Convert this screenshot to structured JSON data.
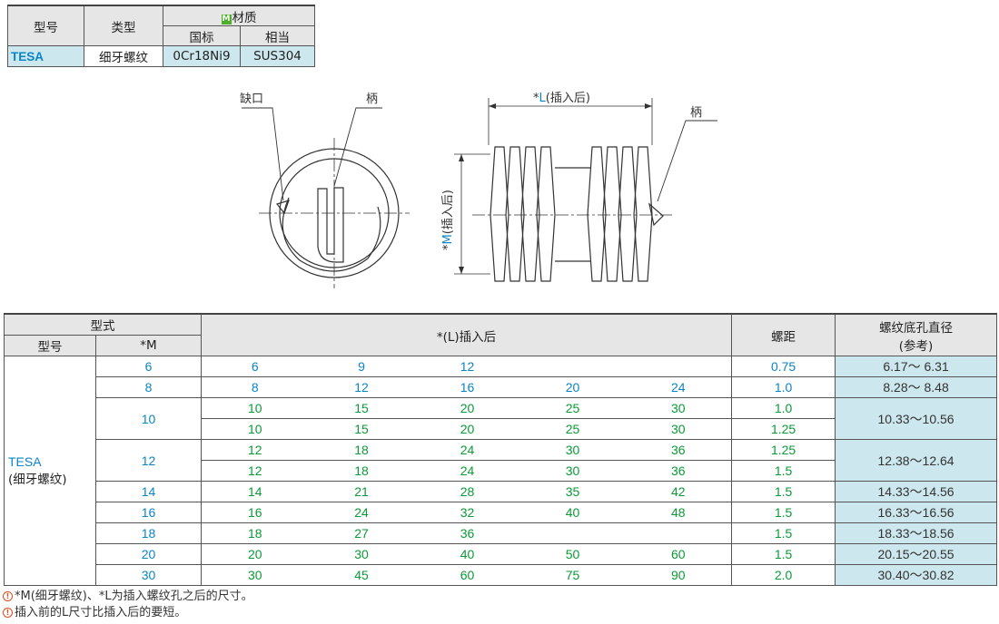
{
  "material_table": {
    "col_model": "型号",
    "col_type": "类型",
    "col_material": "材质",
    "material_badge": "M",
    "col_std": "国标",
    "col_equiv": "相当",
    "row": {
      "model": "TESA",
      "type": "细牙螺纹",
      "std": "0Cr18Ni9",
      "equiv": "SUS304"
    }
  },
  "drawing": {
    "notch_label": "缺口",
    "tang_label": "柄",
    "tang_label_side": "柄",
    "L_label_prefix": "*",
    "L_label_letter": "L",
    "L_label_suffix": "(插入后)",
    "M_label_prefix": "*",
    "M_label_letter": "M",
    "M_label_suffix": "(插入后)"
  },
  "spec_table": {
    "header_type": "型式",
    "header_model": "型号",
    "header_M": "*M",
    "header_L": "*(L)插入后",
    "header_pitch": "螺距",
    "header_hole_line1": "螺纹底孔直径",
    "header_hole_line2": "(参考)",
    "model": "TESA",
    "model_sub": "(细牙螺纹)",
    "rows": [
      {
        "M": "6",
        "L": [
          "6",
          "9",
          "12",
          "",
          ""
        ],
        "pitch": "0.75",
        "hole": "6.17～ 6.31"
      },
      {
        "M": "8",
        "L": [
          "8",
          "12",
          "16",
          "20",
          "24"
        ],
        "pitch": "1.0",
        "hole": "8.28～ 8.48"
      },
      {
        "M": "10",
        "L": [
          "10",
          "15",
          "20",
          "25",
          "30"
        ],
        "pitch": "1.0",
        "hole": "10.33～10.56"
      },
      {
        "M": "",
        "L": [
          "10",
          "15",
          "20",
          "25",
          "30"
        ],
        "pitch": "1.25",
        "hole": ""
      },
      {
        "M": "12",
        "L": [
          "12",
          "18",
          "24",
          "30",
          "36"
        ],
        "pitch": "1.25",
        "hole": "12.38～12.64"
      },
      {
        "M": "",
        "L": [
          "12",
          "18",
          "24",
          "30",
          "36"
        ],
        "pitch": "1.5",
        "hole": ""
      },
      {
        "M": "14",
        "L": [
          "14",
          "21",
          "28",
          "35",
          "42"
        ],
        "pitch": "1.5",
        "hole": "14.33～14.56"
      },
      {
        "M": "16",
        "L": [
          "16",
          "24",
          "32",
          "40",
          "48"
        ],
        "pitch": "1.5",
        "hole": "16.33～16.56"
      },
      {
        "M": "18",
        "L": [
          "18",
          "27",
          "36",
          "",
          ""
        ],
        "pitch": "1.5",
        "hole": "18.33～18.56"
      },
      {
        "M": "20",
        "L": [
          "20",
          "30",
          "40",
          "50",
          "60"
        ],
        "pitch": "1.5",
        "hole": "20.15～20.55"
      },
      {
        "M": "30",
        "L": [
          "30",
          "45",
          "60",
          "75",
          "90"
        ],
        "pitch": "2.0",
        "hole": "30.40～30.82"
      }
    ]
  },
  "notes": [
    "*M(细牙螺纹)、*L为插入螺纹孔之后的尺寸。",
    "插入前的L尺寸比插入后的要短。"
  ],
  "colors": {
    "accent_blue": "#0a84c8",
    "accent_green": "#0a9a36",
    "highlight": "#cce7ed",
    "header_gray": "#e6e6e6"
  }
}
